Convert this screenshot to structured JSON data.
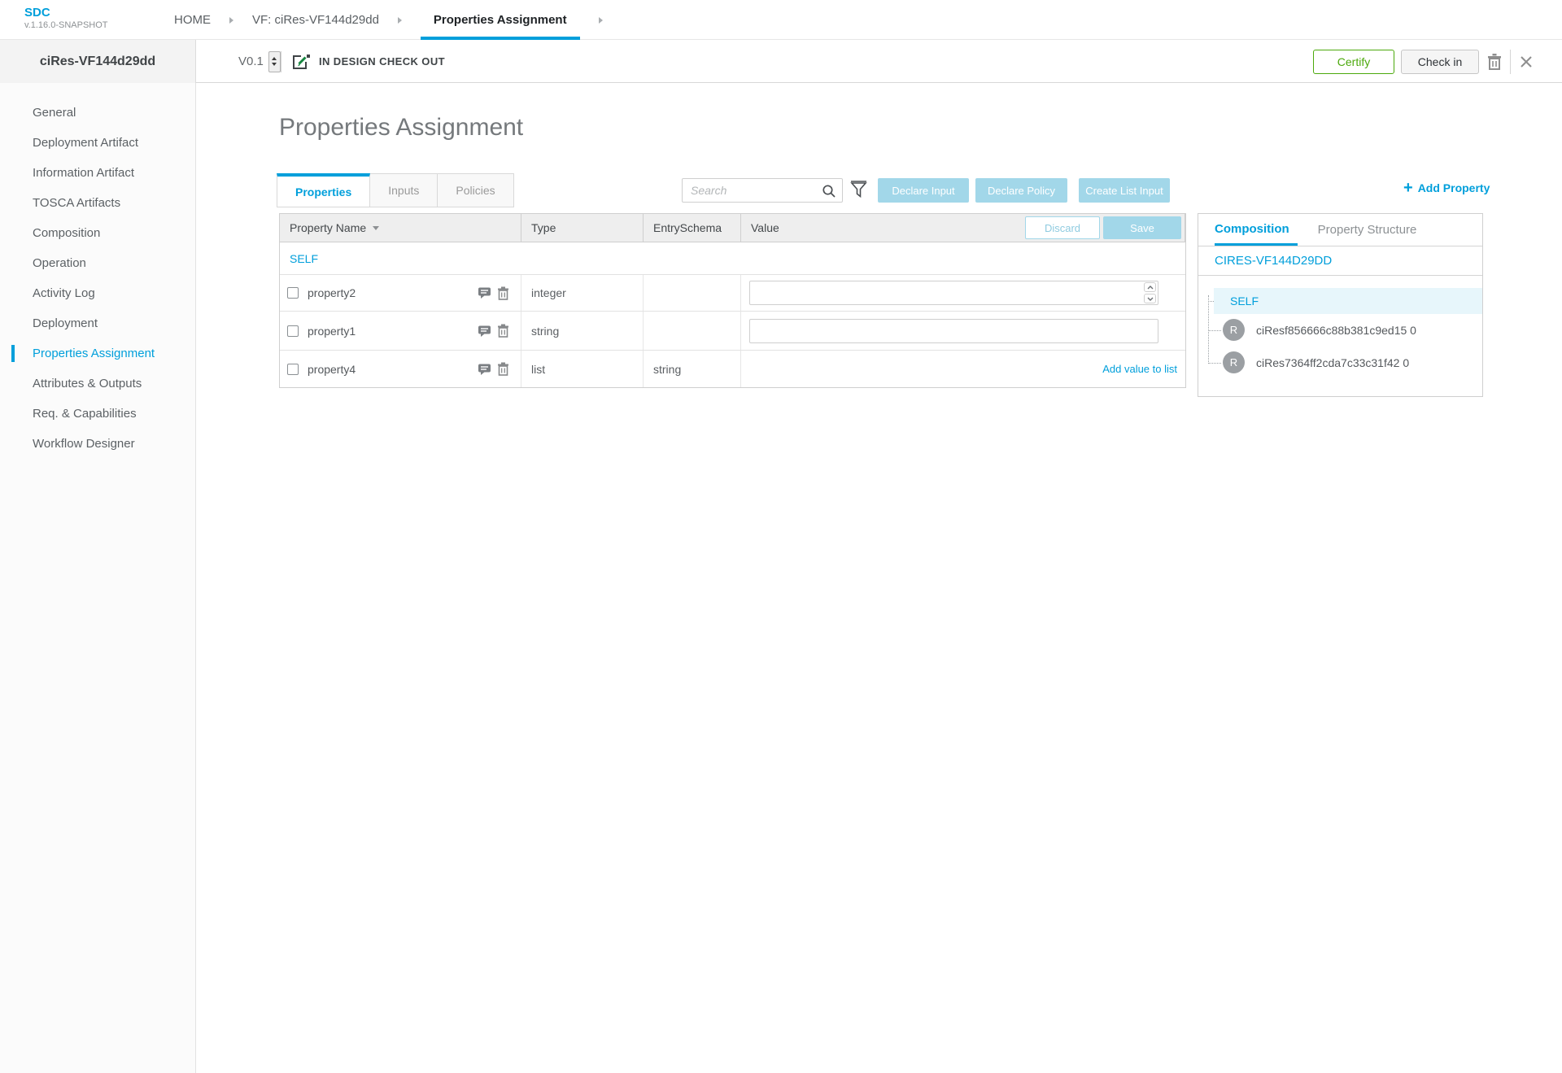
{
  "brand": {
    "name": "SDC",
    "version": "v.1.16.0-SNAPSHOT"
  },
  "breadcrumbs": {
    "items": [
      {
        "label": "HOME"
      },
      {
        "label": "VF: ciRes-VF144d29dd"
      },
      {
        "label": "Properties Assignment"
      }
    ]
  },
  "toolbar": {
    "entity_name": "ciRes-VF144d29dd",
    "version": "V0.1",
    "status": "IN DESIGN CHECK OUT",
    "certify_label": "Certify",
    "checkin_label": "Check in"
  },
  "sidebar": {
    "items": [
      {
        "label": "General"
      },
      {
        "label": "Deployment Artifact"
      },
      {
        "label": "Information Artifact"
      },
      {
        "label": "TOSCA Artifacts"
      },
      {
        "label": "Composition"
      },
      {
        "label": "Operation"
      },
      {
        "label": "Activity Log"
      },
      {
        "label": "Deployment"
      },
      {
        "label": "Properties Assignment"
      },
      {
        "label": "Attributes & Outputs"
      },
      {
        "label": "Req. & Capabilities"
      },
      {
        "label": "Workflow Designer"
      }
    ]
  },
  "main": {
    "title": "Properties Assignment",
    "tabs": [
      {
        "label": "Properties"
      },
      {
        "label": "Inputs"
      },
      {
        "label": "Policies"
      }
    ],
    "search": {
      "placeholder": "Search",
      "value": ""
    },
    "actions": {
      "declare_input": "Declare Input",
      "declare_policy": "Declare Policy",
      "create_list_input": "Create List Input",
      "add_property": "Add Property"
    }
  },
  "table": {
    "headers": {
      "property_name": "Property Name",
      "type": "Type",
      "entry_schema": "EntrySchema",
      "value": "Value"
    },
    "discard_label": "Discard",
    "save_label": "Save",
    "group_label": "SELF",
    "rows": [
      {
        "name": "property2",
        "type": "integer",
        "entry_schema": "",
        "value": "",
        "input_kind": "number"
      },
      {
        "name": "property1",
        "type": "string",
        "entry_schema": "",
        "value": "",
        "input_kind": "text"
      },
      {
        "name": "property4",
        "type": "list",
        "entry_schema": "string",
        "add_link": "Add value to list",
        "input_kind": "list"
      }
    ]
  },
  "composition_panel": {
    "tabs": [
      {
        "label": "Composition"
      },
      {
        "label": "Property Structure"
      }
    ],
    "component_name": "CIRES-VF144D29DD",
    "self_label": "SELF",
    "nodes": [
      {
        "initial": "R",
        "label": "ciResf856666c88b381c9ed15 0"
      },
      {
        "initial": "R",
        "label": "ciRes7364ff2cda7c33c31f42 0"
      }
    ]
  },
  "colors": {
    "accent_blue": "#009fdb",
    "light_blue": "#a2d7e9",
    "certify_green": "#4ca90c",
    "selected_row_bg": "#e7f6fb"
  }
}
